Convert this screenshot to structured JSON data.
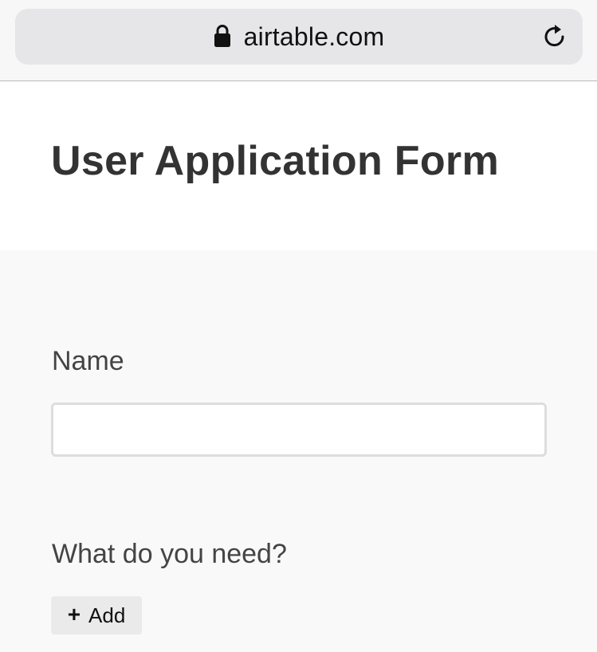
{
  "browser": {
    "url": "airtable.com",
    "lock_icon": "lock-icon",
    "reload_icon": "reload-icon"
  },
  "form": {
    "title": "User Application Form",
    "fields": [
      {
        "label": "Name",
        "value": "",
        "placeholder": ""
      },
      {
        "label": "What do you need?"
      }
    ],
    "add_button": {
      "icon": "+",
      "label": "Add"
    }
  }
}
